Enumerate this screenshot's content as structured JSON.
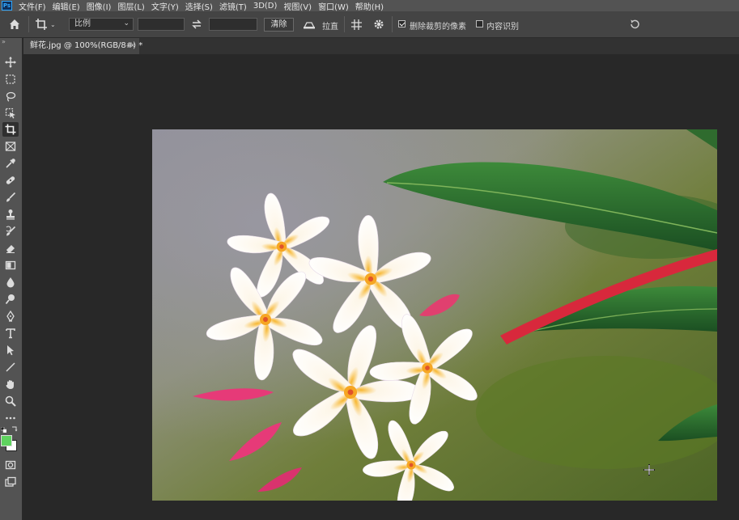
{
  "menubar": {
    "app_icon": "Ps",
    "items": [
      "文件(F)",
      "编辑(E)",
      "图像(I)",
      "图层(L)",
      "文字(Y)",
      "选择(S)",
      "滤镜(T)",
      "3D(D)",
      "视图(V)",
      "窗口(W)",
      "帮助(H)"
    ]
  },
  "options": {
    "ratio_select": "比例",
    "width_value": "",
    "height_value": "",
    "clear_label": "清除",
    "straighten_label": "拉直",
    "delete_cropped_label": "删除裁剪的像素",
    "delete_cropped_checked": true,
    "content_aware_label": "内容识别",
    "content_aware_checked": false
  },
  "document": {
    "tab_title": "鲜花.jpg @ 100%(RGB/8#) *",
    "close_symbol": "×"
  },
  "toolbox": {
    "collapse_symbol": "»",
    "tools": [
      "move-icon",
      "marquee-icon",
      "lasso-icon",
      "object-select-icon",
      "crop-icon",
      "frame-icon",
      "eyedropper-icon",
      "healing-icon",
      "brush-icon",
      "stamp-icon",
      "history-brush-icon",
      "eraser-icon",
      "gradient-icon",
      "blur-icon",
      "dodge-icon",
      "pen-icon",
      "type-icon",
      "path-select-icon",
      "line-icon",
      "hand-icon",
      "zoom-icon",
      "more-icon"
    ],
    "foreground_color": "#5fd35f",
    "background_color": "#ffffff"
  },
  "colors": {
    "canvas_bg": "#282828",
    "menubar": "#535353",
    "optionsbar": "#444444"
  }
}
